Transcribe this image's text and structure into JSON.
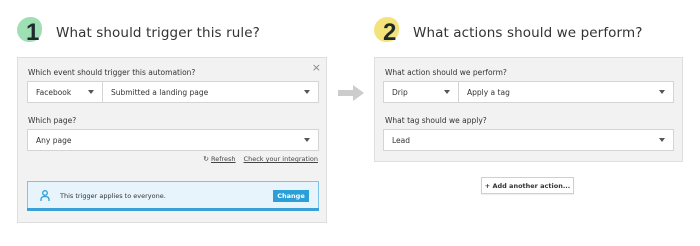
{
  "step1": {
    "number": "1",
    "title": "What should trigger this rule?",
    "event_label": "Which event should trigger this automation?",
    "event_source": "Facebook",
    "event_type": "Submitted a landing page",
    "page_label": "Which page?",
    "page_value": "Any page",
    "refresh_link": "Refresh",
    "check_link": "Check your integration",
    "notice_text": "This trigger applies to everyone.",
    "change_button": "Change",
    "close_glyph": "×"
  },
  "step2": {
    "number": "2",
    "title": "What actions should we perform?",
    "action_label": "What action should we perform?",
    "action_source": "Drip",
    "action_type": "Apply a tag",
    "tag_label": "What tag should we apply?",
    "tag_value": "Lead",
    "add_action_button": "+ Add another action..."
  },
  "icons": {
    "refresh": "refresh-icon",
    "person": "person-icon",
    "arrow": "arrow-right-icon",
    "close": "close-icon",
    "caret": "chevron-down-icon"
  },
  "colors": {
    "step1_blob": "#9ee0b3",
    "step2_blob": "#f3e37a",
    "accent": "#2a9fd8",
    "notice_bg": "#e7f4fb",
    "panel_bg": "#f2f2f2"
  }
}
